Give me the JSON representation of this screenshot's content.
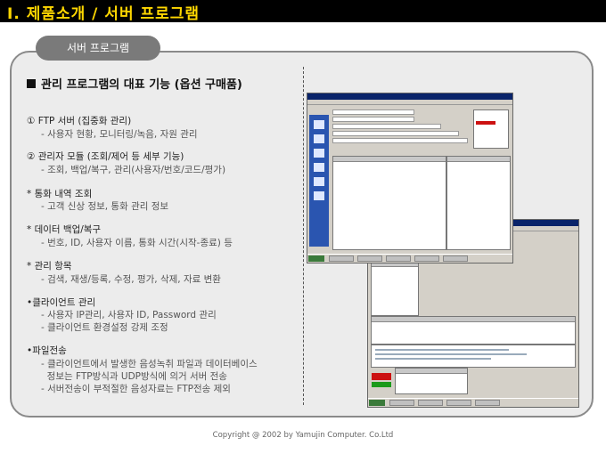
{
  "page": {
    "title": "Ⅰ. 제품소개 / 서버 프로그램",
    "tab_label": "서버 프로그램",
    "heading": "관리 프로그램의 대표 기능 (옵션 구매품)",
    "footer": "Copyright @ 2002 by Yamujin Computer. Co.Ltd"
  },
  "features": [
    {
      "label": "① FTP 서버 (집중화 관리)",
      "subs": [
        "- 사용자 현황, 모니터링/녹음, 자원 관리"
      ]
    },
    {
      "label": "② 관리자 모듈 (조회/제어 등 세부 기능)",
      "subs": [
        "- 조회, 백업/복구, 관리(사용자/번호/코드/평가)"
      ]
    },
    {
      "label": "* 통화 내역 조회",
      "subs": [
        "- 고객 신상 정보, 통화 관리 정보"
      ]
    },
    {
      "label": "* 데이터 백업/복구",
      "subs": [
        "- 번호, ID, 사용자 이름, 통화 시간(시작-종료) 등"
      ]
    },
    {
      "label": "* 관리 항목",
      "subs": [
        "- 검색, 재생/등록, 수정, 평가, 삭제, 자료 변환"
      ]
    },
    {
      "label": "•클라이언트 관리",
      "subs": [
        "- 사용자 IP관리, 사용자 ID, Password 관리",
        "- 클라이언트 환경설정 강제 조정"
      ]
    },
    {
      "label": "•파일전송",
      "subs": [
        "- 클라이언트에서 발생한 음성녹취 파일과 데이터베이스",
        "  정보는 FTP방식과 UDP방식에 의거 서버 전송",
        "- 서버전송이 부적절한 음성자료는 FTP전송 제외"
      ]
    }
  ]
}
